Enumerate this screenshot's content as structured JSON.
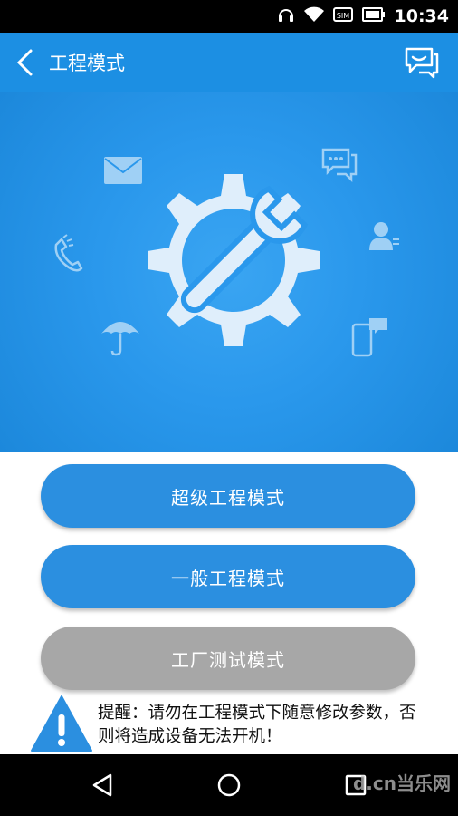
{
  "status_bar": {
    "time": "10:34",
    "sim_label": "SIM"
  },
  "app_bar": {
    "title": "工程模式"
  },
  "buttons": {
    "super": "超级工程模式",
    "general": "一般工程模式",
    "factory": "工厂测试模式"
  },
  "notice": {
    "text": "提醒：请勿在工程模式下随意修改参数，否则将造成设备无法开机！"
  },
  "watermark": "d.cn当乐网",
  "colors": {
    "primary": "#1c8fe3",
    "button_blue": "#2b8fe0",
    "button_gray": "#a7a7a7",
    "warning": "#2b8fe0"
  },
  "icons": [
    "headphones-icon",
    "wifi-icon",
    "sim-icon",
    "battery-icon",
    "back-arrow-icon",
    "message-icon",
    "wrench-gear-icon",
    "mail-icon",
    "chat-icon",
    "phone-icon",
    "contact-icon",
    "umbrella-icon",
    "mobile-message-icon",
    "warning-icon",
    "nav-back-icon",
    "nav-home-icon",
    "nav-recents-icon"
  ]
}
